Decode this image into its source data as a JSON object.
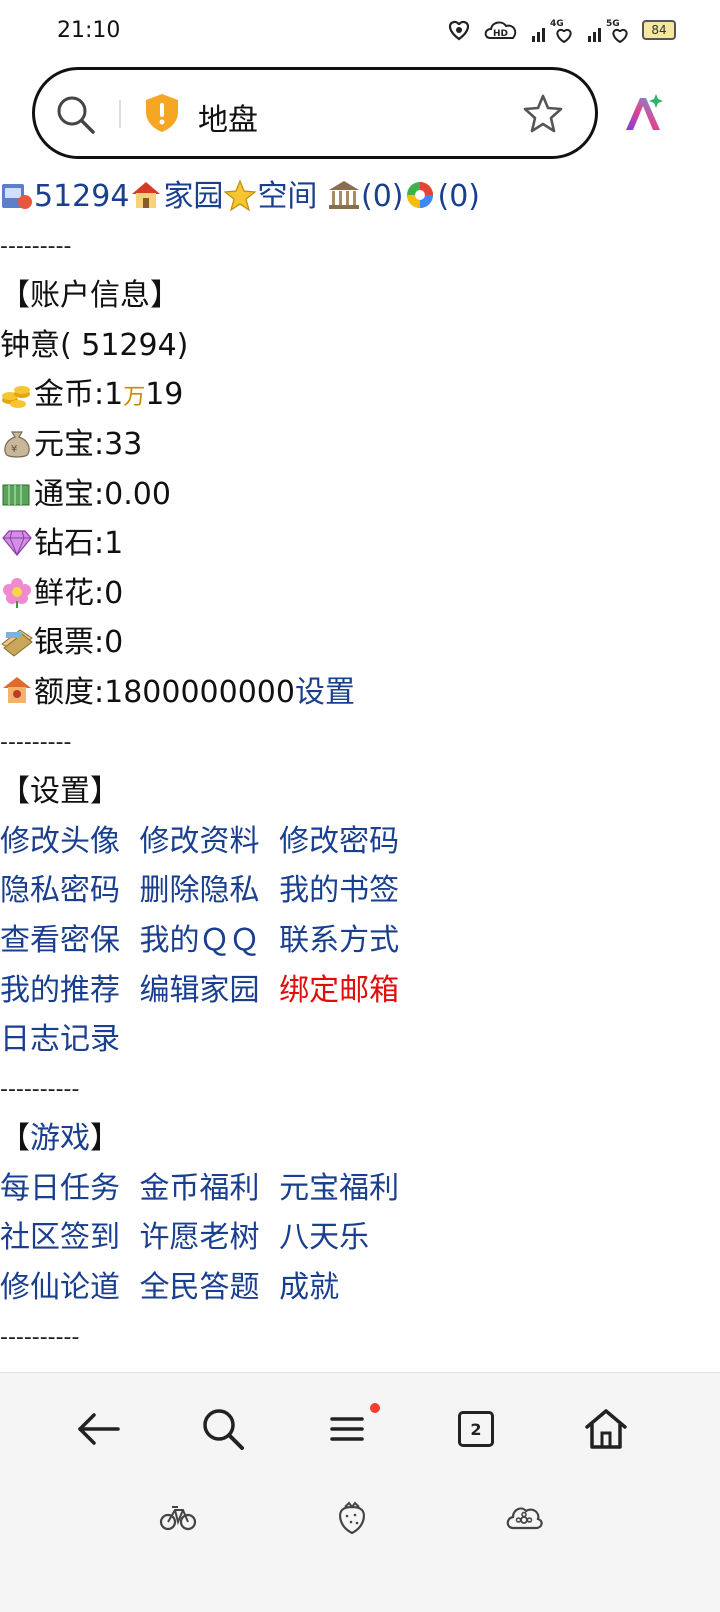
{
  "status": {
    "time": "21:10",
    "battery": "84"
  },
  "address_bar": {
    "url_text": "地盘"
  },
  "top_links": {
    "user_id": "51294",
    "home": "家园",
    "space": "空间",
    "bank": "(0)",
    "colors": "(0)"
  },
  "separator_short": "---------",
  "separator_long": "----------",
  "account": {
    "heading": "【账户信息】",
    "name_line": "钟意( 51294)",
    "gold_label": "金币:1",
    "gold_wan": "万",
    "gold_rest": "19",
    "yuanbao": "元宝:33",
    "tongbao": "通宝:0.00",
    "diamond": "钻石:1",
    "flowers": "鲜花:0",
    "banknote": "银票:0",
    "quota": "额度:1800000000",
    "quota_link": "设置"
  },
  "settings": {
    "heading": "【设置】",
    "rows": [
      [
        "修改头像",
        "修改资料",
        "修改密码"
      ],
      [
        "隐私密码",
        "删除隐私",
        "我的书签"
      ],
      [
        "查看密保",
        "我的ＱＱ",
        "联系方式"
      ],
      [
        "我的推荐",
        "编辑家园",
        "绑定邮箱"
      ],
      [
        "日志记录"
      ]
    ]
  },
  "games": {
    "heading_open": "【",
    "heading_link": "游戏",
    "heading_close": "】",
    "rows": [
      [
        "每日任务",
        "金币福利",
        "元宝福利"
      ],
      [
        "社区签到",
        "许愿老树",
        "八天乐"
      ],
      [
        "修仙论道",
        "全民答题",
        "成就"
      ]
    ]
  },
  "bottom_nav": {
    "tab_count": "2"
  },
  "colors": {
    "link": "#1a3f8f",
    "highlight": "#e20c0c"
  }
}
